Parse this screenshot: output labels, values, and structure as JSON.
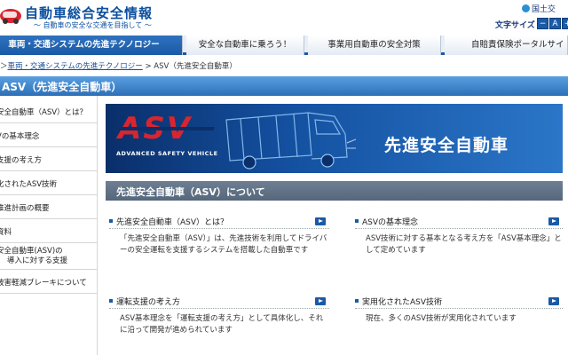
{
  "header": {
    "site_title": "自動車総合安全情報",
    "site_subtitle": "〜 自動車の安全な交通を目指して 〜",
    "ministry": "国土交",
    "font_size_label": "文字サイズ",
    "font_buttons": [
      "−",
      "A",
      "+"
    ]
  },
  "nav": {
    "tabs": [
      {
        "label": "車両・交通システムの先進テクノロジー",
        "active": true
      },
      {
        "label": "安全な自動車に乗ろう！",
        "active": false
      },
      {
        "label": "事業用自動車の安全対策",
        "active": false
      },
      {
        "label": "自賠責保険ポータルサイ",
        "active": false
      }
    ]
  },
  "breadcrumb": {
    "prefix": "＞",
    "link": "車両・交通システムの先進テクノロジー",
    "separator": " > ",
    "current": "ASV（先進安全自動車）"
  },
  "page_title": "ASV（先進安全自動車）",
  "sidebar": {
    "items": [
      {
        "label": "安全自動車（ASV）とは？"
      },
      {
        "label": "Vの基本理念"
      },
      {
        "label": "支援の考え方"
      },
      {
        "label": "化されたASV技術"
      },
      {
        "label": "推進計画の概要"
      },
      {
        "label": "資料"
      },
      {
        "label": "安全自動車(ASV)の",
        "label2": "導入に対する支援"
      },
      {
        "label": "被害軽減ブレーキについて"
      }
    ]
  },
  "banner": {
    "logo": "ASV",
    "logo_sub": "ADVANCED SAFETY VEHICLE",
    "title": "先進安全自動車"
  },
  "section": {
    "title": "先進安全自動車（ASV）について"
  },
  "cards": [
    {
      "title": "先進安全自動車（ASV）とは？",
      "desc": "「先進安全自動車（ASV）」は、先進技術を利用してドライバーの安全運転を支援するシステムを搭載した自動車です"
    },
    {
      "title": "ASVの基本理念",
      "desc": "ASV技術に対する基本となる考え方を「ASV基本理念」として定めています"
    },
    {
      "title": "運転支援の考え方",
      "desc": "ASV基本理念を「運転支援の考え方」として具体化し、それに沿って開発が進められています"
    },
    {
      "title": "実用化されたASV技術",
      "desc": "現在、多くのASV技術が実用化されています"
    }
  ],
  "colors": {
    "brand_blue": "#1a5aa6",
    "title_bar": "#2c6fb8",
    "section_header": "#56677b",
    "asv_red": "#d8252f"
  },
  "icons": [
    "car-logo-icon",
    "arrow-right-icon"
  ]
}
